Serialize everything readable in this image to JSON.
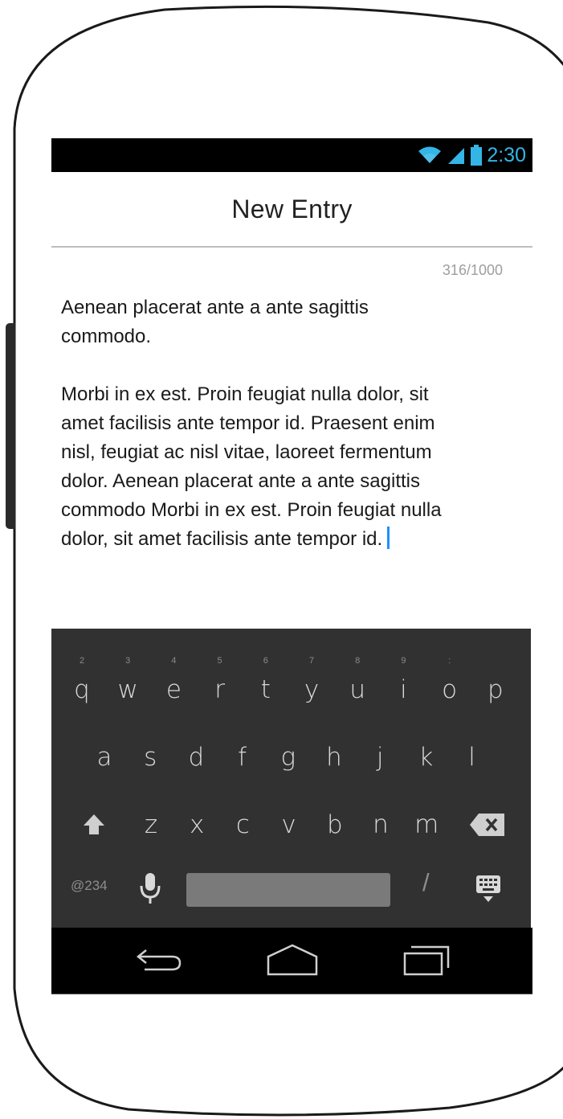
{
  "status_bar": {
    "time": "2:30",
    "icons": [
      "wifi-icon",
      "signal-icon",
      "battery-icon"
    ],
    "time_color": "#33b5e5"
  },
  "header": {
    "title": "New Entry"
  },
  "editor": {
    "char_count": "316/1000",
    "text": "Aenean placerat ante a ante sagittis\ncommodo.\n\nMorbi in ex est. Proin feugiat nulla dolor, sit\namet facilisis ante tempor id. Praesent enim\nnisl, feugiat ac nisl vitae, laoreet fermentum\ndolor. Aenean placerat ante a ante sagittis\ncommodo Morbi in ex est. Proin feugiat nulla\ndolor, sit amet facilisis ante tempor id.",
    "cursor_color": "#1e90ff"
  },
  "keyboard": {
    "row1": [
      "q",
      "w",
      "e",
      "r",
      "t",
      "y",
      "u",
      "i",
      "o",
      "p"
    ],
    "row1_hints": [
      "2",
      "3",
      "4",
      "5",
      "6",
      "7",
      "8",
      "9",
      ":",
      ""
    ],
    "row2": [
      "a",
      "s",
      "d",
      "f",
      "g",
      "h",
      "j",
      "k",
      "l"
    ],
    "row3": [
      "z",
      "x",
      "c",
      "v",
      "b",
      "n",
      "m"
    ],
    "symbols_label": "@234",
    "slash_label": "/",
    "icons": [
      "shift-icon",
      "backspace-icon",
      "microphone-icon",
      "keyboard-hide-icon"
    ]
  },
  "nav_bar": {
    "icons": [
      "back-icon",
      "home-icon",
      "recents-icon"
    ]
  }
}
